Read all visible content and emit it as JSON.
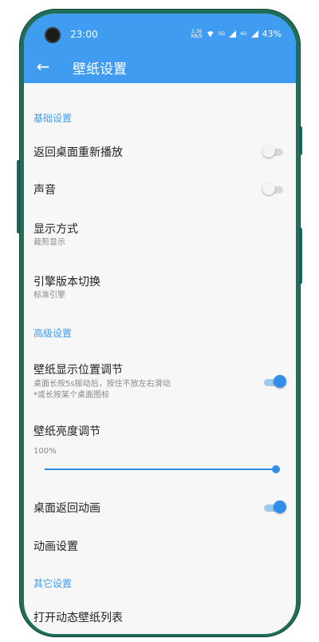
{
  "status_bar": {
    "time": "23:00",
    "speed_value": "2.36",
    "speed_unit": "KB/S",
    "network_label": "5G",
    "network_label_2": "4G",
    "battery": "43%"
  },
  "app_bar": {
    "title": "壁纸设置",
    "back_icon": "arrow-left-icon",
    "color": "#3f9cf1"
  },
  "sections": {
    "basic": "基础设置",
    "advanced": "高级设置",
    "other": "其它设置"
  },
  "items": {
    "replay_on_return": {
      "title": "返回桌面重新播放",
      "enabled": false
    },
    "sound": {
      "title": "声音",
      "enabled": false
    },
    "display_mode": {
      "title": "显示方式",
      "value": "裁剪显示"
    },
    "engine_switch": {
      "title": "引擎版本切换",
      "value": "标准引擎"
    },
    "position_adjust": {
      "title": "壁纸显示位置调节",
      "desc_line1": "桌面长按5s振动后，按住不放左右滑动",
      "desc_line2": "*或长按某个桌面图标",
      "enabled": true
    },
    "brightness": {
      "title": "壁纸亮度调节",
      "value_text": "100%",
      "value": 1.0
    },
    "return_animation": {
      "title": "桌面返回动画",
      "enabled": true
    },
    "animation_settings": {
      "title": "动画设置"
    },
    "open_live_list": {
      "title": "打开动态壁纸列表"
    }
  }
}
